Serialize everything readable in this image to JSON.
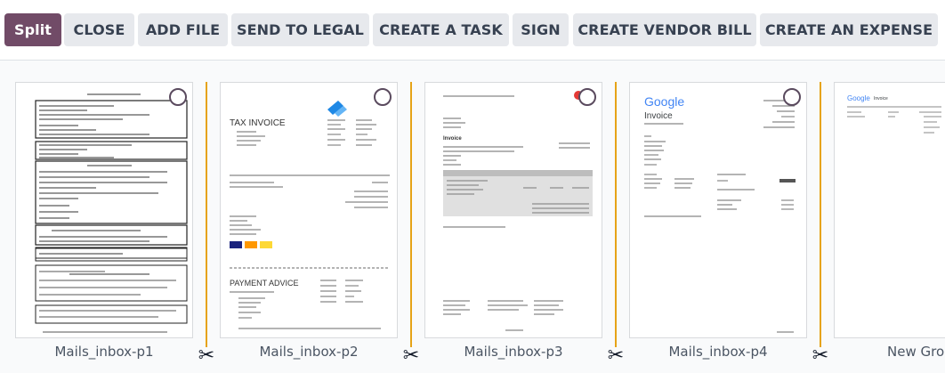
{
  "toolbar": {
    "buttons": [
      "Split",
      "CLOSE",
      "ADD FILE",
      "SEND TO LEGAL",
      "CREATE A TASK",
      "SIGN",
      "CREATE VENDOR BILL",
      "CREATE AN EXPENSE"
    ]
  },
  "pages": [
    {
      "label": "Mails_inbox-p1"
    },
    {
      "label": "Mails_inbox-p2",
      "doc_title": "TAX INVOICE",
      "section": "PAYMENT ADVICE"
    },
    {
      "label": "Mails_inbox-p3",
      "doc_title": "Invoice"
    },
    {
      "label": "Mails_inbox-p4",
      "brand": "Google",
      "doc_title": "Invoice"
    },
    {
      "label": "New Grou",
      "brand": "Google",
      "doc_title": "Invoice"
    }
  ],
  "icons": {
    "split": "scissors-icon",
    "select": "circle-checkbox-icon"
  },
  "colors": {
    "primary": "#714b67",
    "divider": "#e6a317"
  }
}
